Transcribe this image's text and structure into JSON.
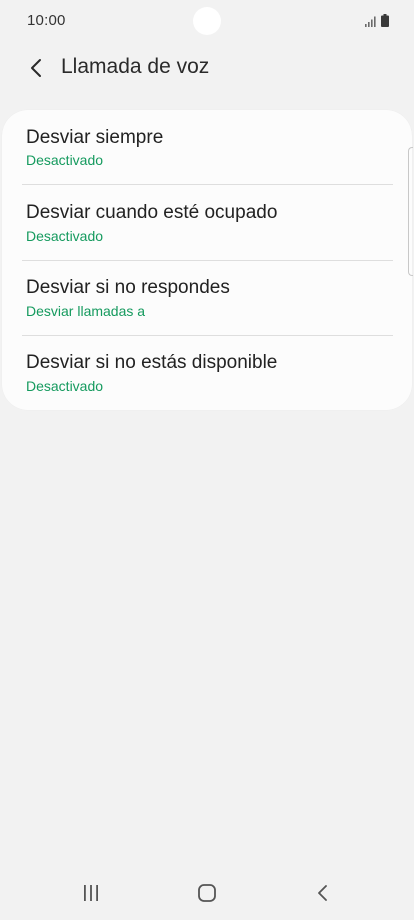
{
  "status_bar": {
    "time": "10:00",
    "signal_icon": "signal-icon",
    "battery_icon": "battery-icon"
  },
  "header": {
    "back_icon": "chevron-left-icon",
    "title": "Llamada de voz"
  },
  "list": {
    "items": [
      {
        "title": "Desviar siempre",
        "subtitle": "Desactivado"
      },
      {
        "title": "Desviar cuando esté ocupado",
        "subtitle": "Desactivado"
      },
      {
        "title": "Desviar si no respondes",
        "subtitle": "Desviar llamadas a"
      },
      {
        "title": "Desviar si no estás disponible",
        "subtitle": "Desactivado"
      }
    ]
  },
  "nav_bar": {
    "recents_icon": "recents-icon",
    "home_icon": "home-icon",
    "back_icon": "back-icon"
  },
  "colors": {
    "background": "#f2f2f2",
    "card": "#fcfcfc",
    "accent_green": "#159a5e",
    "text_primary": "#222222"
  }
}
